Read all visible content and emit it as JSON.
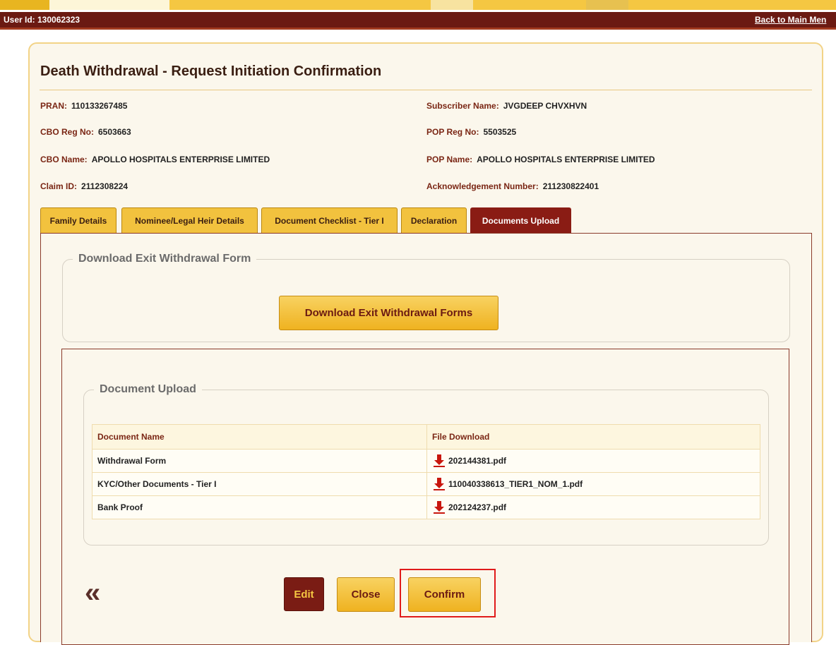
{
  "header": {
    "user_id_label": "User Id: 130062323",
    "back_link": "Back to Main Men"
  },
  "page": {
    "title": "Death Withdrawal - Request Initiation Confirmation"
  },
  "info": {
    "pran_label": "PRAN:",
    "pran_value": "110133267485",
    "subscriber_label": "Subscriber Name:",
    "subscriber_value": "JVGDEEP CHVXHVN",
    "cbo_reg_label": "CBO Reg No:",
    "cbo_reg_value": "6503663",
    "pop_reg_label": "POP Reg No:",
    "pop_reg_value": "5503525",
    "cbo_name_label": "CBO Name:",
    "cbo_name_value": "APOLLO HOSPITALS ENTERPRISE LIMITED",
    "pop_name_label": "POP Name:",
    "pop_name_value": "APOLLO HOSPITALS ENTERPRISE LIMITED",
    "claim_label": "Claim ID:",
    "claim_value": "2112308224",
    "ack_label": "Acknowledgement Number:",
    "ack_value": "211230822401"
  },
  "tabs": [
    {
      "label": "Family Details",
      "active": false
    },
    {
      "label": "Nominee/Legal Heir Details",
      "active": false
    },
    {
      "label": "Document Checklist - Tier I",
      "active": false
    },
    {
      "label": "Declaration",
      "active": false
    },
    {
      "label": "Documents Upload",
      "active": true
    }
  ],
  "download_section": {
    "legend": "Download Exit Withdrawal Form",
    "button": "Download Exit Withdrawal Forms"
  },
  "upload_section": {
    "legend": "Document Upload",
    "columns": [
      "Document Name",
      "File Download"
    ],
    "rows": [
      {
        "name": "Withdrawal Form",
        "file": "202144381.pdf",
        "icon": "download-pdf-icon"
      },
      {
        "name": "KYC/Other Documents - Tier I",
        "file": "110040338613_TIER1_NOM_1.pdf",
        "icon": "download-pdf-icon"
      },
      {
        "name": "Bank Proof",
        "file": "202124237.pdf",
        "icon": "download-pdf-icon"
      }
    ]
  },
  "actions": {
    "back_icon": "double-chevron-left-icon",
    "back_glyph": "«",
    "edit": "Edit",
    "close": "Close",
    "confirm": "Confirm"
  },
  "colors": {
    "header_bar": "#6b1a12",
    "accent_gold": "#f2c23e",
    "active_tab": "#8a1c14",
    "highlight": "#e01b1b"
  }
}
